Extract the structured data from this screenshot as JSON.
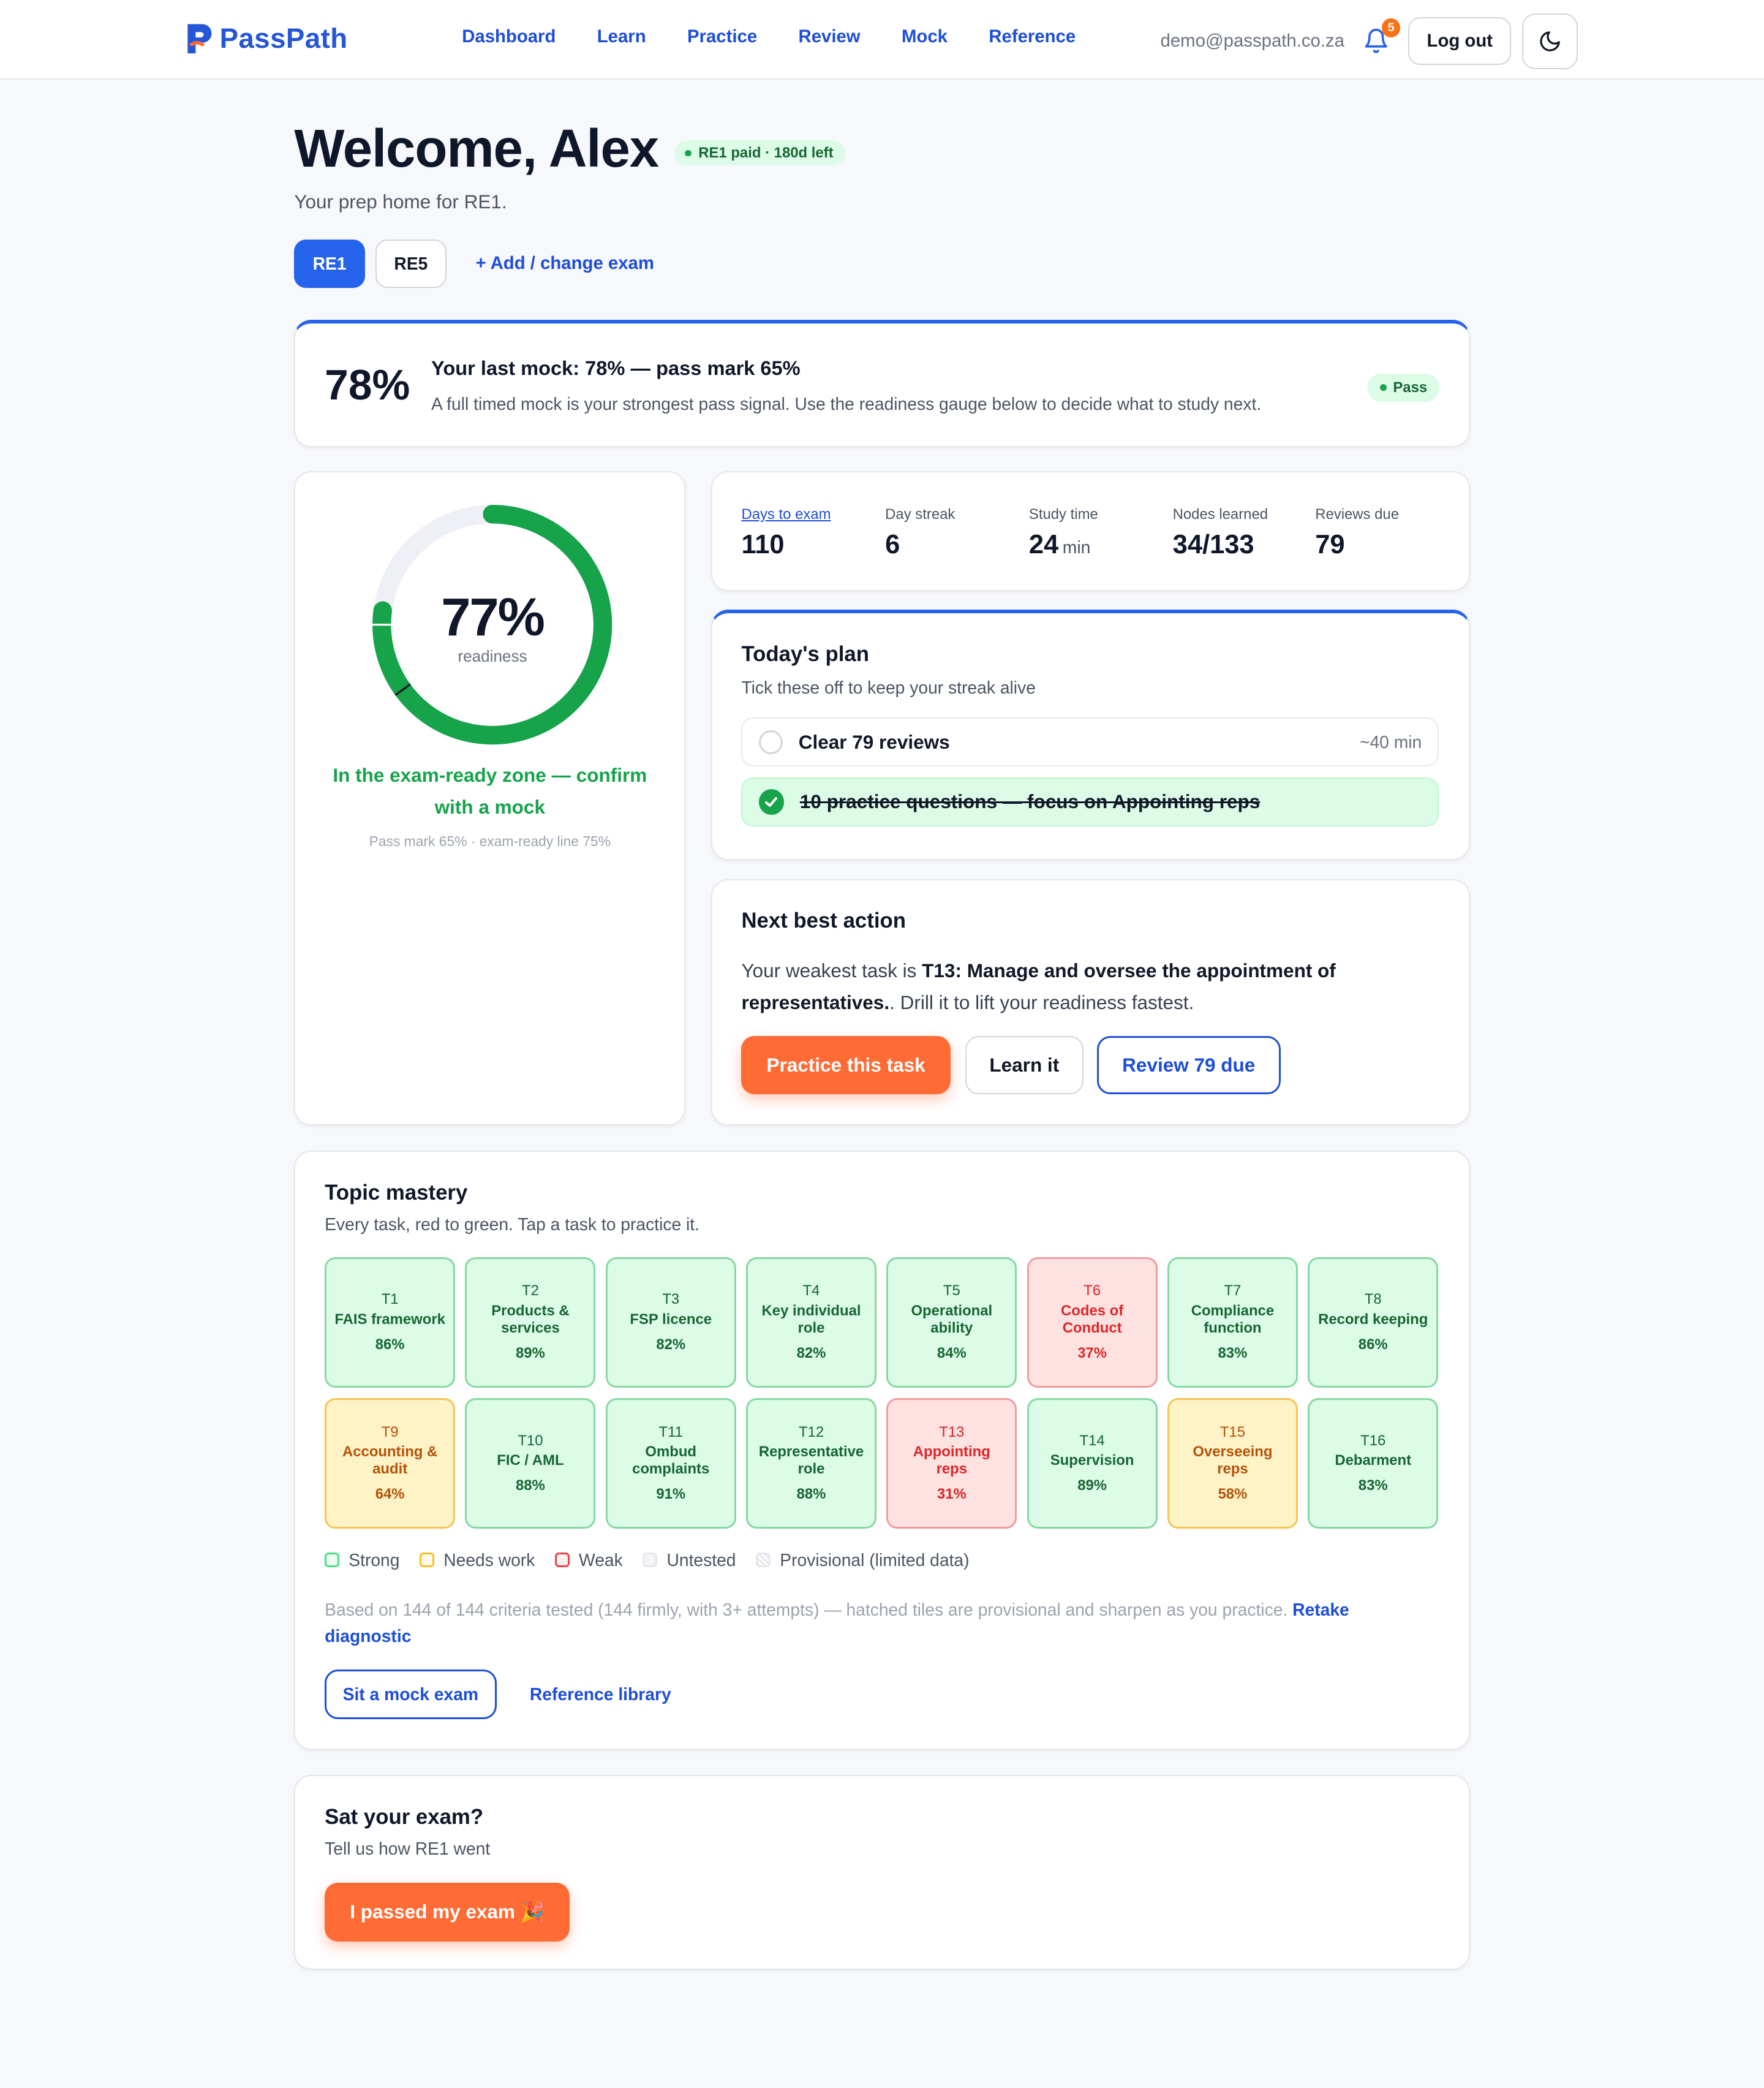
{
  "app": {
    "name": "PassPath"
  },
  "nav": {
    "items": [
      "Dashboard",
      "Learn",
      "Practice",
      "Review",
      "Mock",
      "Reference"
    ]
  },
  "header": {
    "email": "demo@passpath.co.za",
    "notification_count": "5",
    "logout_label": "Log out"
  },
  "welcome": {
    "title": "Welcome, Alex",
    "status_badge": "RE1 paid · 180d left",
    "subtitle": "Your prep home for RE1."
  },
  "exam_tabs": {
    "tabs": [
      "RE1",
      "RE5"
    ],
    "active": "RE1",
    "add_label": "+ Add / change exam"
  },
  "mock": {
    "percent": "78%",
    "title": "Your last mock: 78% — pass mark 65%",
    "description": "A full timed mock is your strongest pass signal. Use the readiness gauge below to decide what to study next.",
    "badge": "Pass"
  },
  "readiness": {
    "percent": "77%",
    "value": 0.77,
    "label": "readiness",
    "zone_text": "In the exam-ready zone — confirm with a mock",
    "note": "Pass mark 65% · exam-ready line 75%",
    "pass_mark": 0.65,
    "ready_line": 0.75,
    "color": "#16a34a"
  },
  "stats": [
    {
      "label": "Days to exam",
      "value": "110",
      "unit": ""
    },
    {
      "label": "Day streak",
      "value": "6",
      "unit": ""
    },
    {
      "label": "Study time",
      "value": "24",
      "unit": "min"
    },
    {
      "label": "Nodes learned",
      "value": "34/133",
      "unit": ""
    },
    {
      "label": "Reviews due",
      "value": "79",
      "unit": ""
    }
  ],
  "plan": {
    "title": "Today's plan",
    "subtitle": "Tick these off to keep your streak alive",
    "items": [
      {
        "text": "Clear 79 reviews",
        "time": "~40 min",
        "done": false
      },
      {
        "text": "10 practice questions — focus on Appointing reps",
        "time": "",
        "done": true
      }
    ]
  },
  "next_action": {
    "title": "Next best action",
    "prefix": "Your weakest task is ",
    "task": "T13: Manage and oversee the appointment of representatives.",
    "suffix": ". Drill it to lift your readiness fastest.",
    "buttons": {
      "practice": "Practice this task",
      "learn": "Learn it",
      "review": "Review 79 due"
    }
  },
  "mastery": {
    "title": "Topic mastery",
    "subtitle": "Every task, red to green. Tap a task to practice it.",
    "tiles": [
      {
        "id": "T1",
        "name": "FAIS framework",
        "pct": "86%",
        "level": "strong"
      },
      {
        "id": "T2",
        "name": "Products & services",
        "pct": "89%",
        "level": "strong"
      },
      {
        "id": "T3",
        "name": "FSP licence",
        "pct": "82%",
        "level": "strong"
      },
      {
        "id": "T4",
        "name": "Key individual role",
        "pct": "82%",
        "level": "strong"
      },
      {
        "id": "T5",
        "name": "Operational ability",
        "pct": "84%",
        "level": "strong"
      },
      {
        "id": "T6",
        "name": "Codes of Conduct",
        "pct": "37%",
        "level": "weak"
      },
      {
        "id": "T7",
        "name": "Compliance function",
        "pct": "83%",
        "level": "strong"
      },
      {
        "id": "T8",
        "name": "Record keeping",
        "pct": "86%",
        "level": "strong"
      },
      {
        "id": "T9",
        "name": "Accounting & audit",
        "pct": "64%",
        "level": "needs"
      },
      {
        "id": "T10",
        "name": "FIC / AML",
        "pct": "88%",
        "level": "strong"
      },
      {
        "id": "T11",
        "name": "Ombud complaints",
        "pct": "91%",
        "level": "strong"
      },
      {
        "id": "T12",
        "name": "Representative role",
        "pct": "88%",
        "level": "strong"
      },
      {
        "id": "T13",
        "name": "Appointing reps",
        "pct": "31%",
        "level": "weak"
      },
      {
        "id": "T14",
        "name": "Supervision",
        "pct": "89%",
        "level": "strong"
      },
      {
        "id": "T15",
        "name": "Overseeing reps",
        "pct": "58%",
        "level": "needs"
      },
      {
        "id": "T16",
        "name": "Debarment",
        "pct": "83%",
        "level": "strong"
      }
    ],
    "legend": [
      "Strong",
      "Needs work",
      "Weak",
      "Untested",
      "Provisional (limited data)"
    ],
    "basis_text": "Based on 144 of 144 criteria tested (144 firmly, with 3+ attempts) — hatched tiles are provisional and sharpen as you practice. ",
    "retake_label": "Retake diagnostic",
    "mock_button": "Sit a mock exam",
    "reference_link": "Reference library"
  },
  "sat_exam": {
    "title": "Sat your exam?",
    "subtitle": "Tell us how RE1 went",
    "button": "I passed my exam 🎉"
  },
  "colors": {
    "brand": "#2456d6",
    "accent": "#ff6b35",
    "link": "#1d4ed8",
    "success": "#16a34a"
  }
}
